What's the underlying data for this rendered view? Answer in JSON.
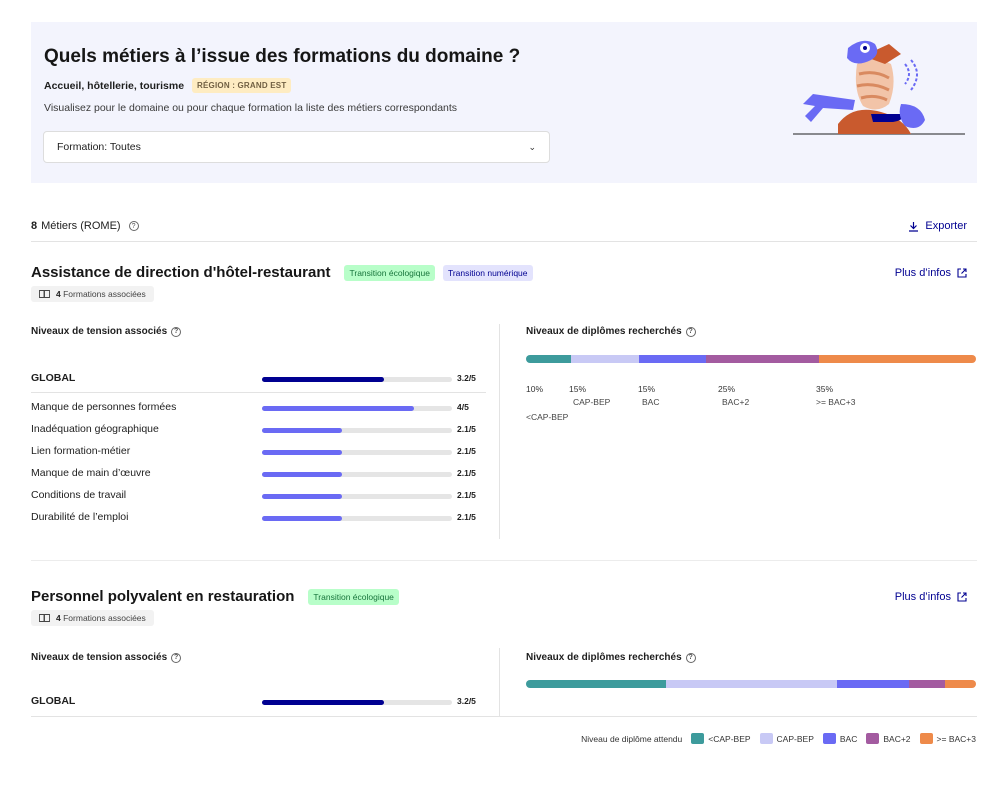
{
  "header": {
    "title": "Quels métiers à l’issue des formations du domaine ?",
    "domain": "Accueil, hôtellerie, tourisme",
    "region_badge": "RÉGION : GRAND EST",
    "description": "Visualisez pour le domaine ou pour chaque formation la liste des métiers correspondants",
    "select_value": "Formation: Toutes"
  },
  "results": {
    "count": "8",
    "count_label": "Métiers (ROME)",
    "export_label": "Exporter"
  },
  "common": {
    "more_info": "Plus d’infos",
    "tension_title": "Niveaux de tension associés",
    "diploma_title": "Niveaux de diplômes recherchés",
    "formations_suffix": "Formations associées"
  },
  "jobs": [
    {
      "title": "Assistance de direction d'hôtel-restaurant",
      "tags": [
        "Transition écologique",
        "Transition numérique"
      ],
      "formations_count": "4",
      "tension": {
        "global": {
          "label": "GLOBAL",
          "value_text": "3.2/5",
          "value": 3.2
        },
        "rows": [
          {
            "label": "Manque de personnes formées",
            "value_text": "4/5",
            "value": 4
          },
          {
            "label": "Inadéquation géographique",
            "value_text": "2.1/5",
            "value": 2.1
          },
          {
            "label": "Lien formation-métier",
            "value_text": "2.1/5",
            "value": 2.1
          },
          {
            "label": "Manque de main d’œuvre",
            "value_text": "2.1/5",
            "value": 2.1
          },
          {
            "label": "Conditions de travail",
            "value_text": "2.1/5",
            "value": 2.1
          },
          {
            "label": "Durabilité de l’emploi",
            "value_text": "2.1/5",
            "value": 2.1
          }
        ]
      },
      "diplomas": [
        {
          "pct": "10%",
          "name": "<CAP-BEP",
          "value": 10
        },
        {
          "pct": "15%",
          "name": "CAP-BEP",
          "value": 15
        },
        {
          "pct": "15%",
          "name": "BAC",
          "value": 15
        },
        {
          "pct": "25%",
          "name": "BAC+2",
          "value": 25
        },
        {
          "pct": "35%",
          "name": ">= BAC+3",
          "value": 35
        }
      ]
    },
    {
      "title": "Personnel polyvalent en restauration",
      "tags": [
        "Transition écologique"
      ],
      "formations_count": "4",
      "tension": {
        "global": {
          "label": "GLOBAL",
          "value_text": "3.2/5",
          "value": 3.2
        }
      },
      "diplomas": [
        {
          "value": 31
        },
        {
          "value": 38
        },
        {
          "value": 16
        },
        {
          "value": 8
        },
        {
          "value": 7
        }
      ]
    }
  ],
  "legend": {
    "title": "Niveau de diplôme attendu",
    "items": [
      {
        "label": "<CAP-BEP",
        "color": "#3d9b9c"
      },
      {
        "label": "CAP-BEP",
        "color": "#c8c9f5"
      },
      {
        "label": "BAC",
        "color": "#6a6af4"
      },
      {
        "label": "BAC+2",
        "color": "#a35ba0"
      },
      {
        "label": ">= BAC+3",
        "color": "#ee8a4a"
      }
    ]
  }
}
